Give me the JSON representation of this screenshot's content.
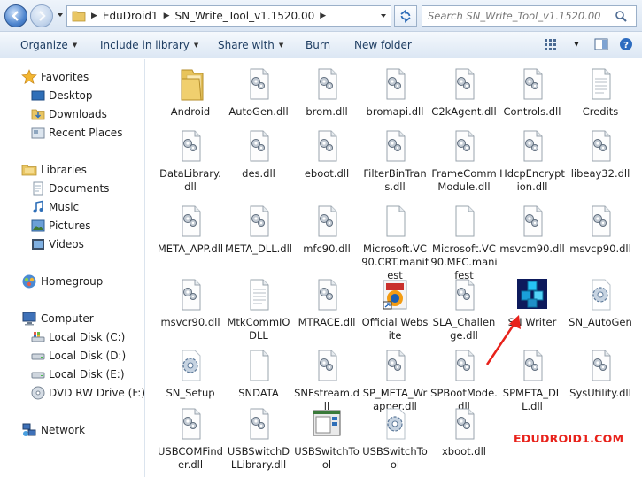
{
  "address": {
    "crumbs": [
      "EduDroid1",
      "SN_Write_Tool_v1.1520.00"
    ]
  },
  "search": {
    "placeholder": "Search SN_Write_Tool_v1.1520.00"
  },
  "toolbar": {
    "organize": "Organize",
    "include_in_library": "Include in library",
    "share_with": "Share with",
    "burn": "Burn",
    "new_folder": "New folder"
  },
  "nav": {
    "favorites": "Favorites",
    "desktop": "Desktop",
    "downloads": "Downloads",
    "recent_places": "Recent Places",
    "libraries": "Libraries",
    "documents": "Documents",
    "music": "Music",
    "pictures": "Pictures",
    "videos": "Videos",
    "homegroup": "Homegroup",
    "computer": "Computer",
    "disk_c": "Local Disk (C:)",
    "disk_d": "Local Disk (D:)",
    "disk_e": "Local Disk (E:)",
    "dvd": "DVD RW Drive (F:) PI",
    "network": "Network"
  },
  "files": [
    {
      "name": "Android",
      "type": "folder"
    },
    {
      "name": "AutoGen.dll",
      "type": "dll"
    },
    {
      "name": "brom.dll",
      "type": "dll"
    },
    {
      "name": "bromapi.dll",
      "type": "dll"
    },
    {
      "name": "C2kAgent.dll",
      "type": "dll"
    },
    {
      "name": "Controls.dll",
      "type": "dll"
    },
    {
      "name": "Credits",
      "type": "text"
    },
    {
      "name": "DataLibrary.dll",
      "type": "dll"
    },
    {
      "name": "des.dll",
      "type": "dll"
    },
    {
      "name": "eboot.dll",
      "type": "dll"
    },
    {
      "name": "FilterBinTrans.dll",
      "type": "dll"
    },
    {
      "name": "FrameCommModule.dll",
      "type": "dll"
    },
    {
      "name": "HdcpEncryption.dll",
      "type": "dll"
    },
    {
      "name": "libeay32.dll",
      "type": "dll"
    },
    {
      "name": "META_APP.dll",
      "type": "dll"
    },
    {
      "name": "META_DLL.dll",
      "type": "dll"
    },
    {
      "name": "mfc90.dll",
      "type": "dll"
    },
    {
      "name": "Microsoft.VC90.CRT.manifest",
      "type": "blank"
    },
    {
      "name": "Microsoft.VC90.MFC.manifest",
      "type": "blank"
    },
    {
      "name": "msvcm90.dll",
      "type": "dll"
    },
    {
      "name": "msvcp90.dll",
      "type": "dll"
    },
    {
      "name": "msvcr90.dll",
      "type": "dll"
    },
    {
      "name": "MtkCommIODLL",
      "type": "text"
    },
    {
      "name": "MTRACE.dll",
      "type": "dll"
    },
    {
      "name": "Official Website",
      "type": "web"
    },
    {
      "name": "SLA_Challenge.dll",
      "type": "dll"
    },
    {
      "name": "SN Writer",
      "type": "app"
    },
    {
      "name": "SN_AutoGen",
      "type": "gear"
    },
    {
      "name": "SN_Setup",
      "type": "gear"
    },
    {
      "name": "SNDATA",
      "type": "blank"
    },
    {
      "name": "SNFstream.dll",
      "type": "dll"
    },
    {
      "name": "SP_META_Wrapper.dll",
      "type": "dll"
    },
    {
      "name": "SPBootMode.dll",
      "type": "dll"
    },
    {
      "name": "SPMETA_DLL.dll",
      "type": "dll"
    },
    {
      "name": "SysUtility.dll",
      "type": "dll"
    },
    {
      "name": "USBCOMFinder.dll",
      "type": "dll"
    },
    {
      "name": "USBSwitchDLLibrary.dll",
      "type": "dll"
    },
    {
      "name": "USBSwitchTool",
      "type": "window"
    },
    {
      "name": "USBSwitchTool",
      "type": "gear"
    },
    {
      "name": "xboot.dll",
      "type": "dll"
    }
  ],
  "watermark": "EDUDROID1.COM",
  "colors": {
    "accent": "#1e3d62",
    "watermark": "#e8221b",
    "arrow": "#e8221b"
  }
}
